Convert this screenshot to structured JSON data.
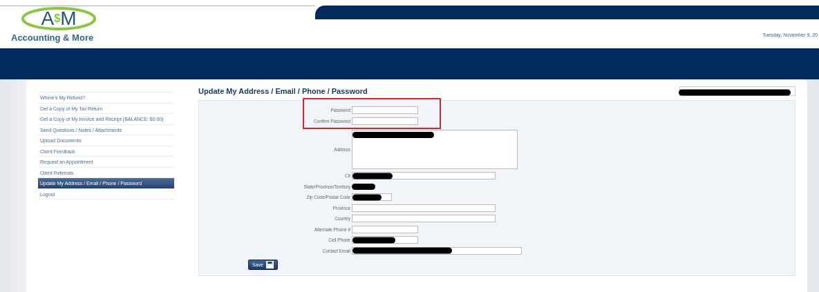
{
  "header": {
    "logo": {
      "mark_left": "A",
      "mark_mid": "$",
      "mark_right": "M",
      "name": "Accounting & More"
    },
    "date": "Tuesday, November 9, 20"
  },
  "sidebar": {
    "items": [
      {
        "label": "Where's My Refund?",
        "selected": false
      },
      {
        "label": "Get a Copy of My Tax Return",
        "selected": false
      },
      {
        "label": "Get a Copy of My Invoice and Receipt (BALANCE: $0.00)",
        "selected": false
      },
      {
        "label": "Send Questions / Notes / Attachments",
        "selected": false
      },
      {
        "label": "Upload Documents",
        "selected": false
      },
      {
        "label": "Client Feedback",
        "selected": false
      },
      {
        "label": "Request an Appointment",
        "selected": false
      },
      {
        "label": "Client Referrals",
        "selected": false
      },
      {
        "label": "Update My Address / Email / Phone / Password",
        "selected": true
      },
      {
        "label": "Logout",
        "selected": false
      }
    ]
  },
  "page_title": "Update My Address / Email / Phone / Password",
  "account_select": {
    "redacted": true
  },
  "form": {
    "fields": [
      {
        "label": "Password",
        "kind": "short",
        "redacted": false,
        "highlighted": true
      },
      {
        "label": "Confirm Password",
        "kind": "short",
        "redacted": false,
        "highlighted": true
      },
      {
        "label": "Address",
        "kind": "textarea",
        "redacted": true,
        "highlighted": false
      },
      {
        "label": "Cit",
        "kind": "long",
        "redacted": true,
        "highlighted": false
      },
      {
        "label": "State/Province/Territory",
        "kind": "none",
        "redacted": true,
        "highlighted": false
      },
      {
        "label": "Zip Code/Postal Code",
        "kind": "tiny",
        "redacted": true,
        "highlighted": false
      },
      {
        "label": "Province",
        "kind": "long",
        "redacted": false,
        "highlighted": false
      },
      {
        "label": "Country",
        "kind": "long",
        "redacted": false,
        "highlighted": false
      },
      {
        "label": "Alternate Phone #",
        "kind": "short",
        "redacted": false,
        "highlighted": false
      },
      {
        "label": "Cell Phone",
        "kind": "short",
        "redacted": true,
        "highlighted": false
      },
      {
        "label": "Contact Email",
        "kind": "wide",
        "redacted": true,
        "highlighted": false
      }
    ],
    "save_label": "Save"
  }
}
